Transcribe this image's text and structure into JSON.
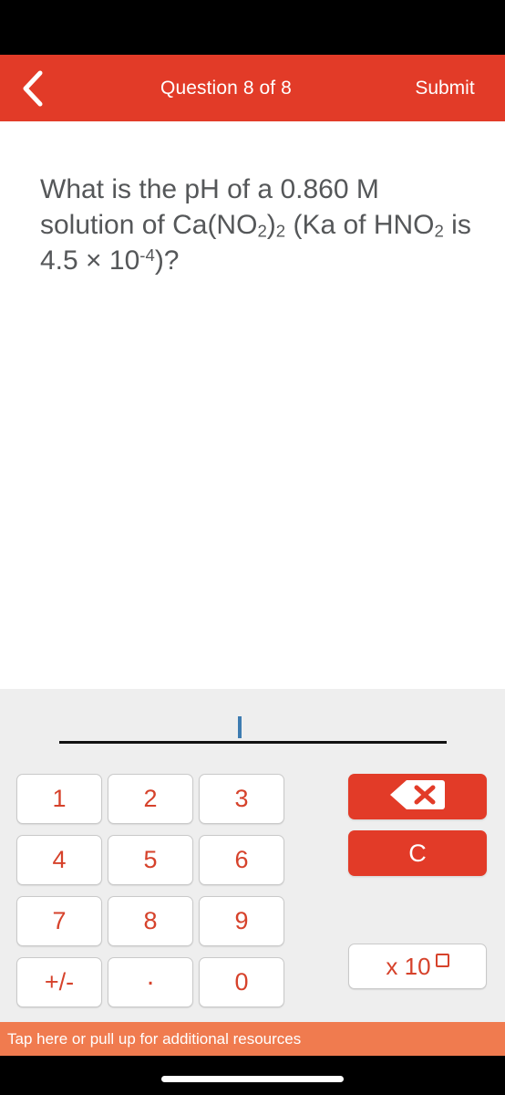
{
  "header": {
    "back_icon": "chevron-left-icon",
    "title": "Question 8 of 8",
    "submit_label": "Submit",
    "background_color": "#E23B28",
    "text_color": "#FFFFFF"
  },
  "question": {
    "part1": "What is the pH of a 0.860 M solution of Ca(NO",
    "sub1": "2",
    "part2": ")",
    "sub2": "2",
    "part3": " (Ka of HNO",
    "sub3": "2",
    "part4": " is 4.5 × 10",
    "sup1": "-4",
    "part5": ")?",
    "full_text": "What is the pH of a 0.860 M solution of Ca(NO2)2 (Ka of HNO2 is 4.5 × 10-4)?",
    "text_color": "#555759"
  },
  "answer_input": {
    "value": "",
    "caret_visible": true,
    "caret_color": "#3E7CB1",
    "line_color": "#111111"
  },
  "keypad": {
    "background_color": "#EEEEEE",
    "key_text_color": "#D6422B",
    "rows": [
      [
        "1",
        "2",
        "3"
      ],
      [
        "4",
        "5",
        "6"
      ],
      [
        "7",
        "8",
        "9"
      ],
      [
        "+/-",
        ".",
        "0"
      ]
    ]
  },
  "actions": {
    "backspace_icon": "backspace-icon",
    "clear_label": "C",
    "exponent_prefix": "x 10",
    "exponent_placeholder": "□",
    "button_color": "#E23B28"
  },
  "resources_bar": {
    "label": "Tap here or pull up for additional resources",
    "background_color": "#F07B4F"
  }
}
